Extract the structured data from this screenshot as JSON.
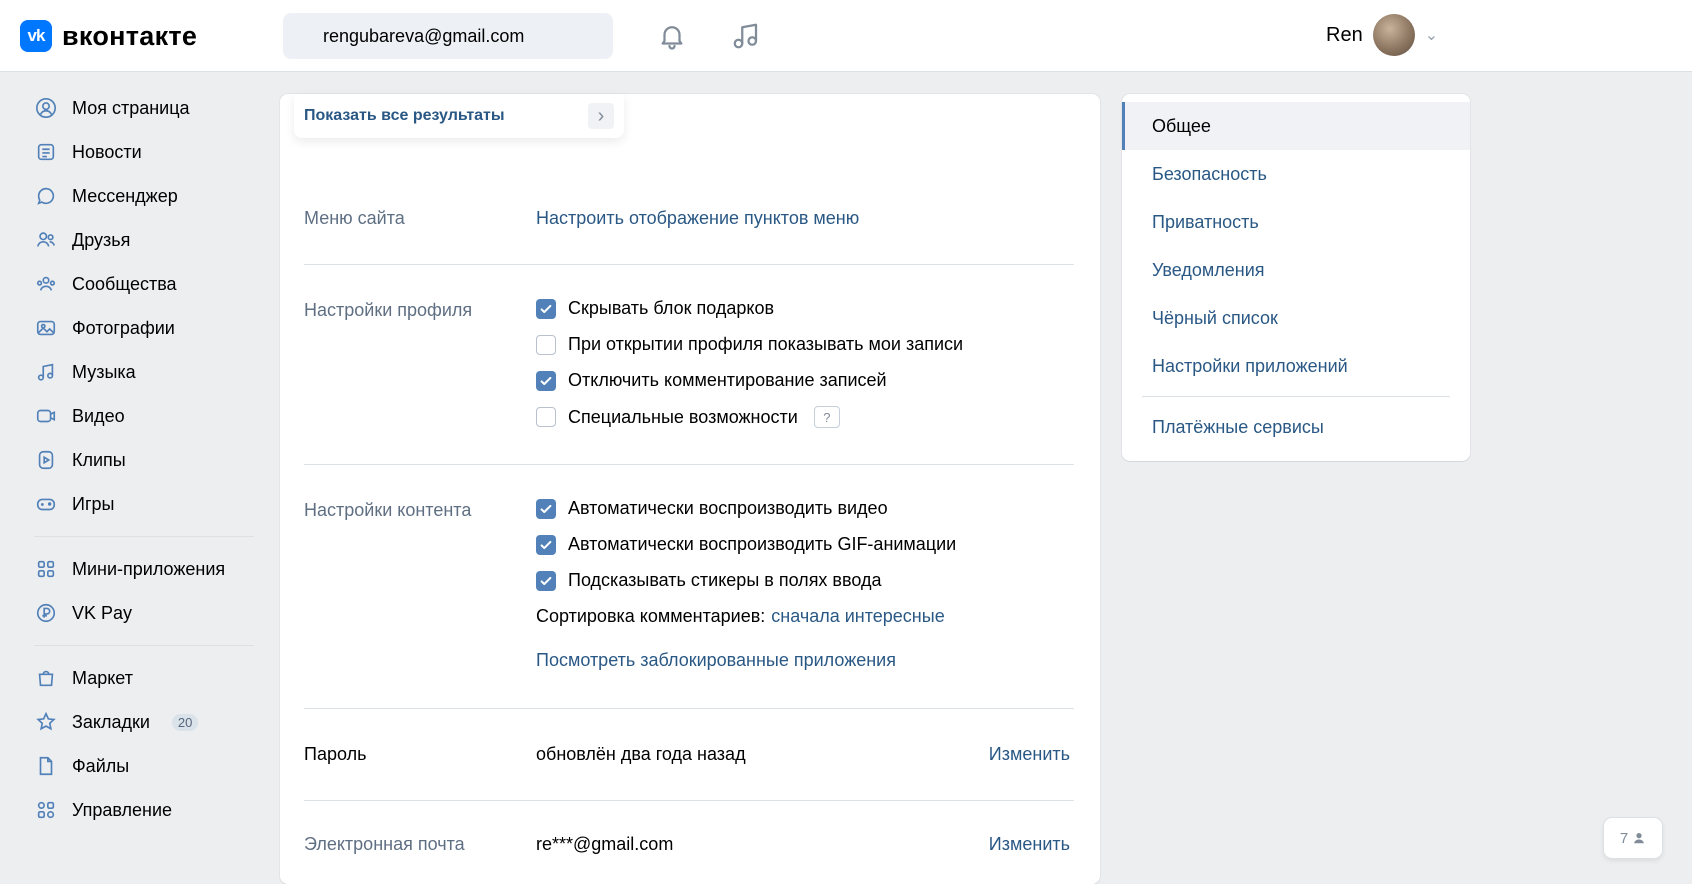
{
  "header": {
    "logo_text": "вконтакте",
    "logo_mark": "vk",
    "search_value": "rengubareva@gmail.com",
    "user_name": "Ren"
  },
  "sidebar": {
    "items": [
      {
        "label": "Моя страница",
        "icon": "user-icon"
      },
      {
        "label": "Новости",
        "icon": "news-icon"
      },
      {
        "label": "Мессенджер",
        "icon": "message-icon"
      },
      {
        "label": "Друзья",
        "icon": "friends-icon"
      },
      {
        "label": "Сообщества",
        "icon": "groups-icon"
      },
      {
        "label": "Фотографии",
        "icon": "photo-icon"
      },
      {
        "label": "Музыка",
        "icon": "music-icon"
      },
      {
        "label": "Видео",
        "icon": "video-icon"
      },
      {
        "label": "Клипы",
        "icon": "clips-icon"
      },
      {
        "label": "Игры",
        "icon": "games-icon"
      }
    ],
    "items2": [
      {
        "label": "Мини-приложения",
        "icon": "apps-icon"
      },
      {
        "label": "VK Pay",
        "icon": "vkpay-icon"
      }
    ],
    "items3": [
      {
        "label": "Маркет",
        "icon": "market-icon"
      },
      {
        "label": "Закладки",
        "icon": "bookmark-icon",
        "badge": "20"
      },
      {
        "label": "Файлы",
        "icon": "files-icon"
      },
      {
        "label": "Управление",
        "icon": "manage-icon"
      }
    ]
  },
  "search_dropdown": {
    "label": "Показать все результаты"
  },
  "main": {
    "site_menu": {
      "title": "Меню сайта",
      "link": "Настроить отображение пунктов меню"
    },
    "profile": {
      "title": "Настройки профиля",
      "options": [
        {
          "label": "Скрывать блок подарков",
          "checked": true
        },
        {
          "label": "При открытии профиля показывать мои записи",
          "checked": false
        },
        {
          "label": "Отключить комментирование записей",
          "checked": true
        },
        {
          "label": "Специальные возможности",
          "checked": false,
          "help": "?"
        }
      ]
    },
    "content": {
      "title": "Настройки контента",
      "options": [
        {
          "label": "Автоматически воспроизводить видео",
          "checked": true
        },
        {
          "label": "Автоматически воспроизводить GIF-анимации",
          "checked": true
        },
        {
          "label": "Подсказывать стикеры в полях ввода",
          "checked": true
        }
      ],
      "sort_label": "Сортировка комментариев:",
      "sort_value": "сначала интересные",
      "blocked_apps": "Посмотреть заблокированные приложения"
    },
    "password": {
      "title": "Пароль",
      "value": "обновлён два года назад",
      "action": "Изменить"
    },
    "email": {
      "title": "Электронная почта",
      "value": "re***@gmail.com",
      "action": "Изменить"
    }
  },
  "right_menu": {
    "items": [
      "Общее",
      "Безопасность",
      "Приватность",
      "Уведомления",
      "Чёрный список",
      "Настройки приложений",
      "Платёжные сервисы"
    ]
  },
  "friends_fab": {
    "count": "7"
  },
  "colors": {
    "accent": "#5181b8",
    "link": "#2a5885",
    "background": "#edeef0"
  }
}
